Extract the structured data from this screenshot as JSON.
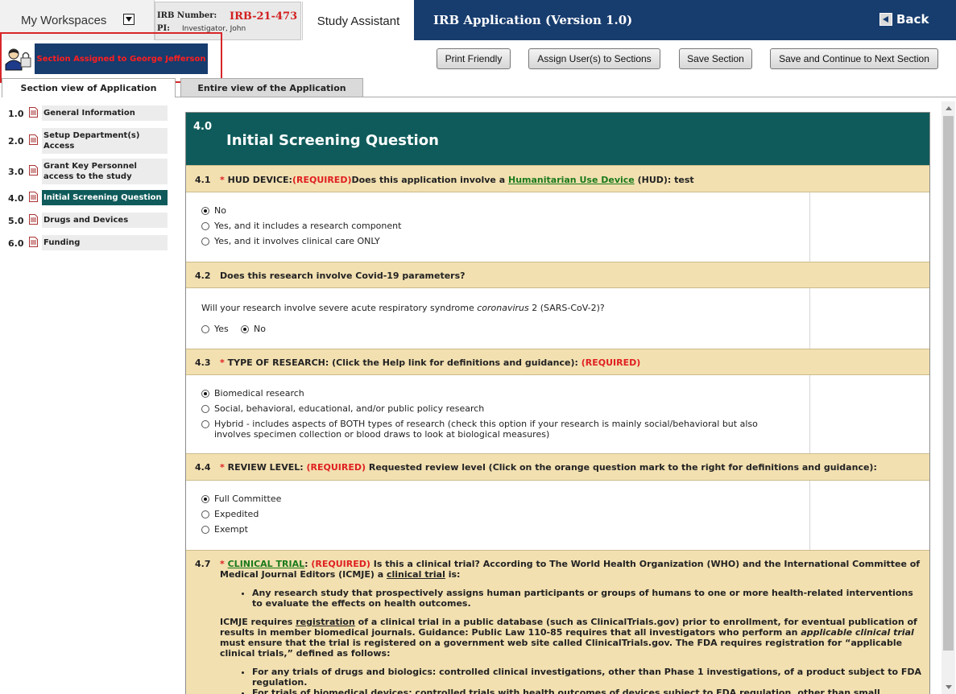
{
  "topbar": {
    "workspaces_label": "My Workspaces",
    "irb_number_key": "IRB Number:",
    "irb_number": "IRB-21-473",
    "pi_key": "PI:",
    "pi_name": "Investigator, John",
    "assistant_tab": "Study Assistant",
    "app_title": "IRB Application (Version 1.0)",
    "back_label": "Back"
  },
  "assignment": {
    "label": "Section Assigned to George Jefferson"
  },
  "toolbar": {
    "print": "Print Friendly",
    "assign": "Assign User(s) to Sections",
    "save": "Save Section",
    "save_next": "Save and Continue to Next Section"
  },
  "tabs": {
    "section_view": "Section view of Application",
    "entire_view": "Entire view of the Application"
  },
  "sidebar": [
    {
      "num": "1.0",
      "label": "General Information"
    },
    {
      "num": "2.0",
      "label": "Setup Department(s) Access"
    },
    {
      "num": "3.0",
      "label": "Grant Key Personnel access to the study"
    },
    {
      "num": "4.0",
      "label": "Initial Screening Question"
    },
    {
      "num": "5.0",
      "label": "Drugs and Devices"
    },
    {
      "num": "6.0",
      "label": "Funding"
    }
  ],
  "section": {
    "number": "4.0",
    "title": "Initial Screening Question"
  },
  "q41": {
    "num": "4.1",
    "star": "*",
    "pre": "HUD DEVICE:",
    "req": "(REQUIRED)",
    "mid": "Does this application involve a",
    "link": "Humanitarian Use Device",
    "post": "(HUD): test",
    "options": [
      "No",
      "Yes, and it includes a research component",
      "Yes, and it involves clinical care ONLY"
    ]
  },
  "q42": {
    "num": "4.2",
    "title": "Does this research involve Covid-19 parameters?",
    "prompt_a": "Will your research involve severe acute respiratory syndrome",
    "prompt_i": "coronavirus",
    "prompt_b": "2 (SARS-CoV-2)?",
    "yes": "Yes",
    "no": "No"
  },
  "q43": {
    "num": "4.3",
    "star": "*",
    "title": "TYPE OF RESEARCH: (Click the Help link for definitions and guidance):",
    "req": "(REQUIRED)",
    "options": [
      "Biomedical research",
      "Social, behavioral, educational, and/or public policy research",
      "Hybrid - includes aspects of BOTH types of research (check this option if your research is mainly social/behavioral but also involves specimen collection or blood draws to look at biological measures)"
    ]
  },
  "q44": {
    "num": "4.4",
    "star": "*",
    "pre": "REVIEW LEVEL:",
    "req": "(REQUIRED)",
    "post": "Requested review level (Click on the orange question mark to the right for definitions and guidance):",
    "options": [
      "Full Committee",
      "Expedited",
      "Exempt"
    ]
  },
  "q47": {
    "num": "4.7",
    "star": "*",
    "link": "CLINICAL TRIAL",
    "colon": ":",
    "req": "(REQUIRED)",
    "text1": "Is this a clinical trial? According to The World Health Organization (WHO) and the International Committee of Medical Journal Editors (ICMJE) a",
    "text1_link": "clinical trial",
    "text1_end": "is:",
    "bullet1": "Any research study that prospectively assigns human participants or groups of humans to one or more health-related interventions to evaluate the effects on health outcomes.",
    "p2_a": "ICMJE requires",
    "p2_link": "registration",
    "p2_b": "of a clinical trial in a public database (such as ClinicalTrials.gov) prior to enrollment, for eventual publication of results in member biomedical journals. Guidance: Public Law 110-85 requires that all investigators who perform an",
    "p2_i": "applicable clinical trial",
    "p2_c": "must ensure that the trial is registered on a government web site called ClinicalTrials.gov.   The FDA requires registration for “applicable clinical trials,” defined as follows:",
    "bullet2": "For any trials of drugs and biologics: controlled clinical investigations, other than Phase 1 investigations, of a product subject to FDA regulation.",
    "bullet3": "For trials of biomedical devices: controlled trials with health outcomes of devices subject to FDA regulation, other than small"
  }
}
